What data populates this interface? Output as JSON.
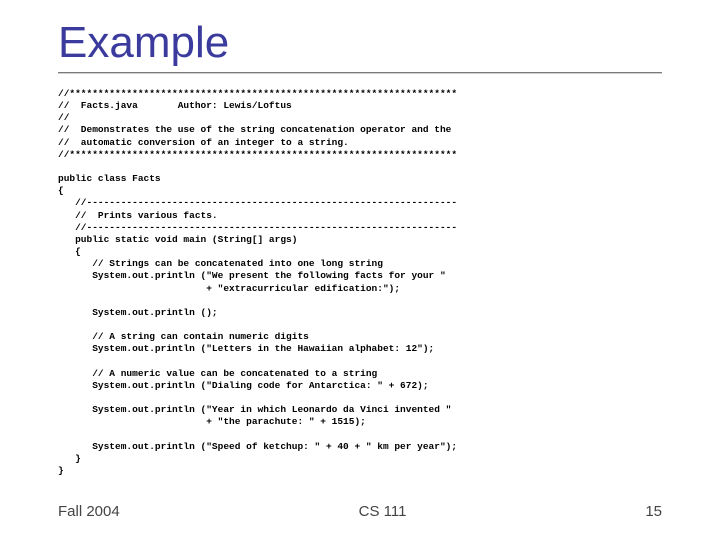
{
  "title": "Example",
  "code": "//********************************************************************\n//  Facts.java       Author: Lewis/Loftus\n//\n//  Demonstrates the use of the string concatenation operator and the\n//  automatic conversion of an integer to a string.\n//********************************************************************\n\npublic class Facts\n{\n   //-----------------------------------------------------------------\n   //  Prints various facts.\n   //-----------------------------------------------------------------\n   public static void main (String[] args)\n   {\n      // Strings can be concatenated into one long string\n      System.out.println (\"We present the following facts for your \"\n                          + \"extracurricular edification:\");\n\n      System.out.println ();\n\n      // A string can contain numeric digits\n      System.out.println (\"Letters in the Hawaiian alphabet: 12\");\n\n      // A numeric value can be concatenated to a string\n      System.out.println (\"Dialing code for Antarctica: \" + 672);\n\n      System.out.println (\"Year in which Leonardo da Vinci invented \"\n                          + \"the parachute: \" + 1515);\n\n      System.out.println (\"Speed of ketchup: \" + 40 + \" km per year\");\n   }\n}",
  "footer": {
    "left": "Fall 2004",
    "center": "CS 111",
    "right": "15"
  }
}
